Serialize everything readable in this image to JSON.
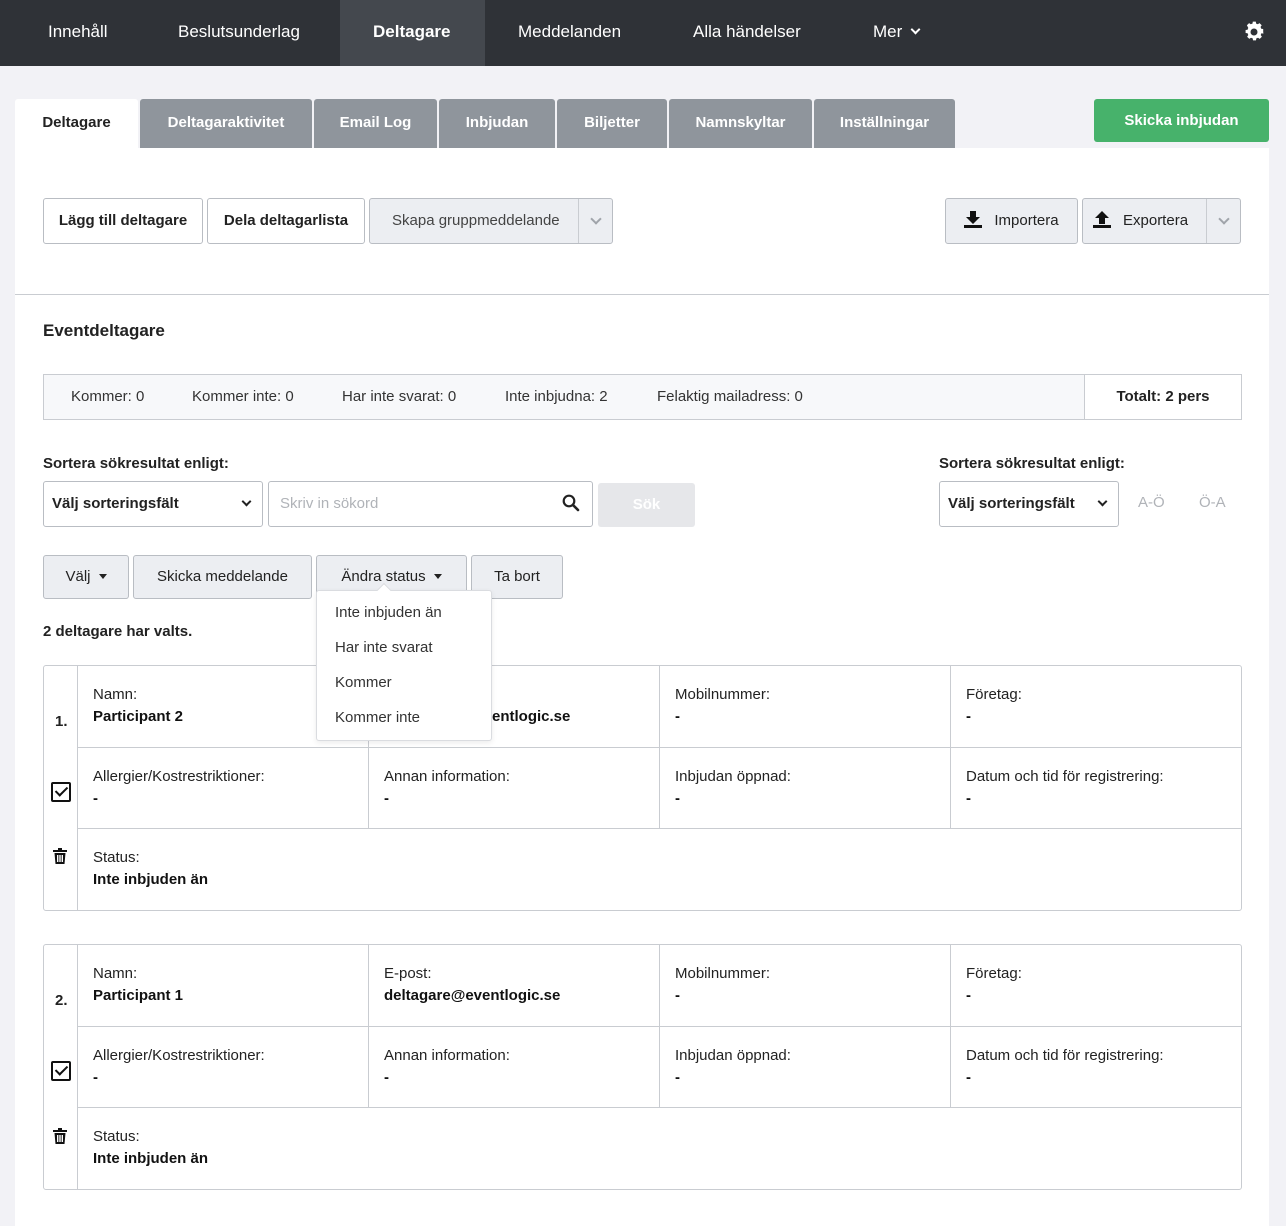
{
  "nav": {
    "items": [
      "Innehåll",
      "Beslutsunderlag",
      "Deltagare",
      "Meddelanden",
      "Alla händelser",
      "Mer"
    ],
    "active": "Deltagare"
  },
  "tabs": [
    "Deltagare",
    "Deltagaraktivitet",
    "Email Log",
    "Inbjudan",
    "Biljetter",
    "Namnskyltar",
    "Inställningar"
  ],
  "send_invite_button": "Skicka inbjudan",
  "toolbar": {
    "add_participant": "Lägg till deltagare",
    "share_list": "Dela deltagarlista",
    "group_message": "Skapa gruppmeddelande",
    "import": "Importera",
    "export": "Exportera"
  },
  "section_title": "Eventdeltagare",
  "stats": {
    "coming": "Kommer: 0",
    "not_coming": "Kommer inte: 0",
    "no_answer": "Har inte svarat: 0",
    "not_invited": "Inte inbjudna: 2",
    "bad_email": "Felaktig mailadress: 0",
    "total": "Totalt: 2 pers"
  },
  "search": {
    "sort_label_left": "Sortera sökresultat enligt:",
    "sort_select_left": "Välj sorteringsfält",
    "placeholder": "Skriv in sökord",
    "search_button": "Sök",
    "sort_label_right": "Sortera sökresultat enligt:",
    "sort_select_right": "Välj sorteringsfält",
    "sort_az": "A-Ö",
    "sort_za": "Ö-A"
  },
  "actions": {
    "select": "Välj",
    "send_message": "Skicka meddelande",
    "change_status": "Ändra status",
    "delete": "Ta bort"
  },
  "status_dropdown": [
    "Inte inbjuden än",
    "Har inte svarat",
    "Kommer",
    "Kommer inte"
  ],
  "selected_text": "2 deltagare har valts.",
  "labels": {
    "name": "Namn:",
    "email": "E-post:",
    "mobile": "Mobilnummer:",
    "company": "Företag:",
    "allergies": "Allergier/Kostrestriktioner:",
    "other_info": "Annan information:",
    "invite_opened": "Inbjudan öppnad:",
    "registered_at": "Datum och tid för registrering:",
    "status": "Status:"
  },
  "participants": [
    {
      "index": "1.",
      "name": "Participant 2",
      "email": "entlogic.se",
      "mobile": "-",
      "company": "-",
      "allergies": "-",
      "other_info": "-",
      "invite_opened": "-",
      "registered_at": "-",
      "status": "Inte inbjuden än"
    },
    {
      "index": "2.",
      "name": "Participant 1",
      "email": "deltagare@eventlogic.se",
      "mobile": "-",
      "company": "-",
      "allergies": "-",
      "other_info": "-",
      "invite_opened": "-",
      "registered_at": "-",
      "status": "Inte inbjuden än"
    }
  ],
  "colors": {
    "nav_bg": "#2f3237",
    "tab_inactive": "#8f959c",
    "primary_green": "#47b26b"
  }
}
